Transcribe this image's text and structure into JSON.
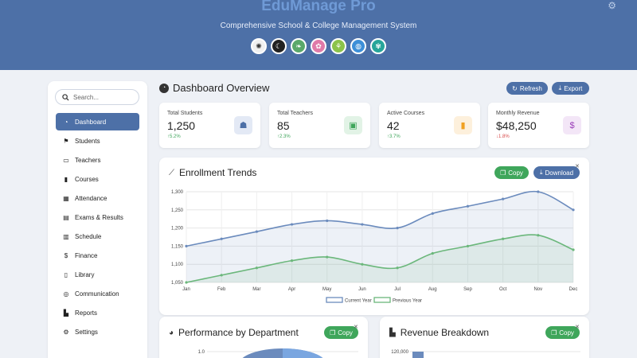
{
  "app": {
    "title": "EduManage Pro",
    "subtitle": "Comprehensive School & College Management System"
  },
  "themes": [
    {
      "name": "light",
      "icon": "sun-icon",
      "glyph": "✺",
      "color": "#f0f0f0",
      "fg": "#333"
    },
    {
      "name": "dark",
      "icon": "moon-icon",
      "glyph": "☾",
      "color": "#222222",
      "fg": "#fff"
    },
    {
      "name": "leaf",
      "icon": "leaf-icon",
      "glyph": "❧",
      "color": "#5aa86a",
      "fg": "#fff"
    },
    {
      "name": "pink",
      "icon": "palette-icon",
      "glyph": "✿",
      "color": "#e07aa8",
      "fg": "#fff"
    },
    {
      "name": "seedling",
      "icon": "seedling-icon",
      "glyph": "⚘",
      "color": "#8bc34a",
      "fg": "#fff"
    },
    {
      "name": "water",
      "icon": "droplet-icon",
      "glyph": "◍",
      "color": "#3d8fd8",
      "fg": "#fff"
    },
    {
      "name": "lotus",
      "icon": "lotus-icon",
      "glyph": "✾",
      "color": "#27a59a",
      "fg": "#fff"
    }
  ],
  "sidebar": {
    "search_placeholder": "Search...",
    "items": [
      {
        "label": "Dashboard",
        "glyph": "◔",
        "active": true
      },
      {
        "label": "Students",
        "glyph": "⚑",
        "active": false
      },
      {
        "label": "Teachers",
        "glyph": "▭",
        "active": false
      },
      {
        "label": "Courses",
        "glyph": "▮",
        "active": false
      },
      {
        "label": "Attendance",
        "glyph": "▦",
        "active": false
      },
      {
        "label": "Exams & Results",
        "glyph": "▤",
        "active": false
      },
      {
        "label": "Schedule",
        "glyph": "▥",
        "active": false
      },
      {
        "label": "Finance",
        "glyph": "$",
        "active": false
      },
      {
        "label": "Library",
        "glyph": "▯",
        "active": false
      },
      {
        "label": "Communication",
        "glyph": "◎",
        "active": false
      },
      {
        "label": "Reports",
        "glyph": "▙",
        "active": false
      },
      {
        "label": "Settings",
        "glyph": "⚙",
        "active": false
      }
    ]
  },
  "main": {
    "title": "Dashboard Overview",
    "refresh_label": "Refresh",
    "export_label": "Export"
  },
  "stats": [
    {
      "label": "Total Students",
      "value": "1,250",
      "change": "5.2%",
      "dir": "up",
      "icon": "graduate-icon",
      "glyph": "☗",
      "bg": "#e3e9f5",
      "fg": "#4d70a7"
    },
    {
      "label": "Total Teachers",
      "value": "85",
      "change": "2.3%",
      "dir": "up",
      "icon": "chalkboard-icon",
      "glyph": "▣",
      "bg": "#e2f3e6",
      "fg": "#3fa65b"
    },
    {
      "label": "Active Courses",
      "value": "42",
      "change": "3.7%",
      "dir": "up",
      "icon": "book-icon",
      "glyph": "▮",
      "bg": "#fdf0dc",
      "fg": "#f0a020"
    },
    {
      "label": "Monthly Revenue",
      "value": "$48,250",
      "change": "1.8%",
      "dir": "down",
      "icon": "dollar-icon",
      "glyph": "$",
      "bg": "#f3e6f7",
      "fg": "#9b3fb8"
    }
  ],
  "enrollment": {
    "title": "Enrollment Trends",
    "copy_label": "Copy",
    "download_label": "Download"
  },
  "performance": {
    "title": "Performance by Department",
    "copy_label": "Copy"
  },
  "revenue": {
    "title": "Revenue Breakdown",
    "copy_label": "Copy"
  },
  "chart_data": [
    {
      "type": "area",
      "categories": [
        "Jan",
        "Feb",
        "Mar",
        "Apr",
        "May",
        "Jun",
        "Jul",
        "Aug",
        "Sep",
        "Oct",
        "Nov",
        "Dec"
      ],
      "series": [
        {
          "name": "Current Year",
          "color": "#6b8bbd",
          "values": [
            1150,
            1170,
            1190,
            1210,
            1220,
            1210,
            1200,
            1240,
            1260,
            1280,
            1300,
            1250
          ]
        },
        {
          "name": "Previous Year",
          "color": "#6bb77b",
          "values": [
            1050,
            1070,
            1090,
            1110,
            1120,
            1100,
            1090,
            1130,
            1150,
            1170,
            1180,
            1140
          ]
        }
      ],
      "ylim": [
        1050,
        1300
      ],
      "yticks": [
        "1,050",
        "1,100",
        "1,150",
        "1,200",
        "1,250",
        "1,300"
      ],
      "grid": true,
      "legend": "bottom"
    },
    {
      "type": "pie",
      "title": "",
      "yticks": [
        "1.0"
      ],
      "note": "partially visible"
    },
    {
      "type": "bar",
      "yticks": [
        "120,000"
      ],
      "note": "partially visible"
    }
  ]
}
